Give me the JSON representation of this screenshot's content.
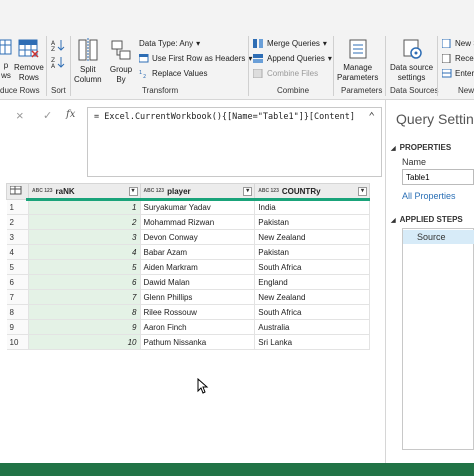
{
  "ribbon": {
    "left_buttons": [
      {
        "label_lines": [
          "p",
          "ws"
        ]
      },
      {
        "label_lines": [
          "Remove",
          "Rows"
        ]
      }
    ],
    "reduce_rows_label": "duce Rows",
    "sort_label": "Sort",
    "split_column": [
      "Split",
      "Column"
    ],
    "group_by": [
      "Group",
      "By"
    ],
    "data_type": "Data Type: Any",
    "first_row_headers": "Use First Row as Headers",
    "replace_values": "Replace Values",
    "transform_label": "Transform",
    "merge_queries": "Merge Queries",
    "append_queries": "Append Queries",
    "combine_files": "Combine Files",
    "combine_label": "Combine",
    "manage_parameters": [
      "Manage",
      "Parameters"
    ],
    "parameters_label": "Parameters",
    "data_source_settings": [
      "Data source",
      "settings"
    ],
    "data_sources_label": "Data Sources",
    "new_source": "New S",
    "recent_sources": "Recen",
    "enter_data": "Enter",
    "new_query_label": "New",
    "accent_color": "#217346"
  },
  "formula": {
    "cancel_icon": "×",
    "confirm_icon": "✓",
    "fx_icon": "fx",
    "text": "= Excel.CurrentWorkbook(){[Name=\"Table1\"]}[Content]",
    "collapse_icon": "⌃"
  },
  "table": {
    "columns": [
      {
        "type": "ABC 123",
        "name": "raNK"
      },
      {
        "type": "ABC 123",
        "name": "player"
      },
      {
        "type": "ABC 123",
        "name": "COUNTRy"
      }
    ],
    "rows": [
      {
        "n": "1",
        "rank": "1",
        "player": "Suryakumar Yadav",
        "country": "India"
      },
      {
        "n": "2",
        "rank": "2",
        "player": "Mohammad Rizwan",
        "country": "Pakistan"
      },
      {
        "n": "3",
        "rank": "3",
        "player": "Devon Conway",
        "country": "New Zealand"
      },
      {
        "n": "4",
        "rank": "4",
        "player": "Babar Azam",
        "country": "Pakistan"
      },
      {
        "n": "5",
        "rank": "5",
        "player": "Aiden Markram",
        "country": "South Africa"
      },
      {
        "n": "6",
        "rank": "6",
        "player": "Dawid Malan",
        "country": "England"
      },
      {
        "n": "7",
        "rank": "7",
        "player": "Glenn Phillips",
        "country": "New Zealand"
      },
      {
        "n": "8",
        "rank": "8",
        "player": "Rilee Rossouw",
        "country": "South Africa"
      },
      {
        "n": "9",
        "rank": "9",
        "player": "Aaron Finch",
        "country": "Australia"
      },
      {
        "n": "10",
        "rank": "10",
        "player": "Pathum Nissanka",
        "country": "Sri Lanka"
      }
    ]
  },
  "query_settings": {
    "title": "Query Setting",
    "properties_header": "PROPERTIES",
    "name_label": "Name",
    "name_value": "Table1",
    "all_properties": "All Properties",
    "applied_steps_header": "APPLIED STEPS",
    "steps": [
      "Source"
    ]
  }
}
